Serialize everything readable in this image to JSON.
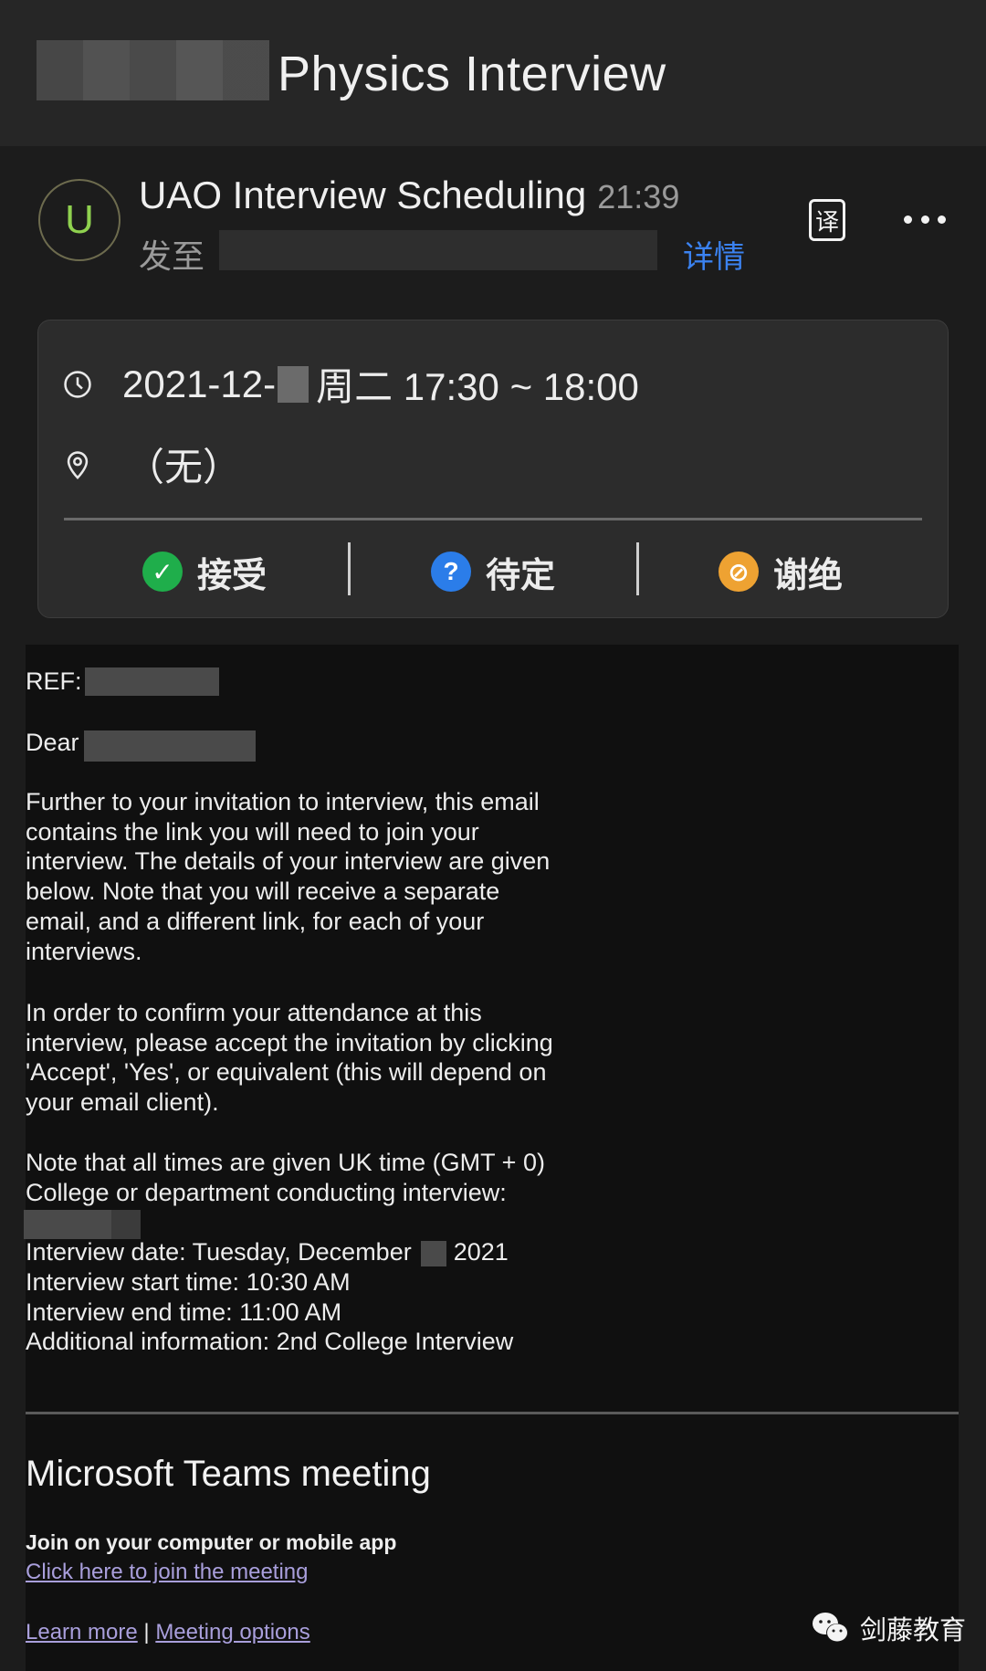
{
  "header": {
    "title_redacted": true,
    "title": "Physics Interview"
  },
  "sender": {
    "avatar_letter": "U",
    "name": "UAO Interview Scheduling",
    "time": "21:39",
    "to_label": "发至",
    "details_link": "详情",
    "translate_icon_label": "译",
    "more_icon": "more-horizontal-icon"
  },
  "event": {
    "date_prefix": "2021-12-",
    "date_suffix": "周二 17:30 ~ 18:00",
    "location": "（无）",
    "responses": [
      {
        "label": "接受",
        "icon": "check-circle-icon",
        "color": "#1fae4b",
        "glyph": "✓"
      },
      {
        "label": "待定",
        "icon": "question-circle-icon",
        "color": "#2b7de9",
        "glyph": "?"
      },
      {
        "label": "谢绝",
        "icon": "decline-circle-icon",
        "color": "#eea232",
        "glyph": "⊘"
      }
    ]
  },
  "email": {
    "ref_label": "REF:",
    "dear_label": "Dear",
    "para1": [
      "Further to your invitation to interview, this email",
      "contains the link you will need to join your",
      "interview. The details of your interview are given",
      "below. Note that you will receive a separate",
      "email, and a different link, for each of your",
      "interviews."
    ],
    "para2": [
      "In order to confirm your attendance at this",
      "interview, please accept the invitation by clicking",
      "'Accept', 'Yes', or equivalent (this will depend on",
      "your email client)."
    ],
    "timezone_note": "Note that all times are given UK time (GMT + 0)",
    "college_label": "College or department conducting interview:",
    "date_line_prefix": "Interview date: Tuesday, December",
    "date_line_year": "2021",
    "start_time": "Interview start time: 10:30 AM",
    "end_time": "Interview end time: 11:00 AM",
    "additional": "Additional information: 2nd College Interview"
  },
  "teams": {
    "title": "Microsoft Teams meeting",
    "join_label": "Join on your computer or mobile app",
    "join_link": "Click here to join the meeting",
    "learn_more": "Learn more",
    "separator": "|",
    "meeting_options": "Meeting options"
  },
  "watermark": {
    "account": "剑藤教育"
  },
  "colors": {
    "accent_link": "#3b82f0",
    "teams_link": "#a99fdc",
    "avatar_letter": "#8fd14f"
  }
}
